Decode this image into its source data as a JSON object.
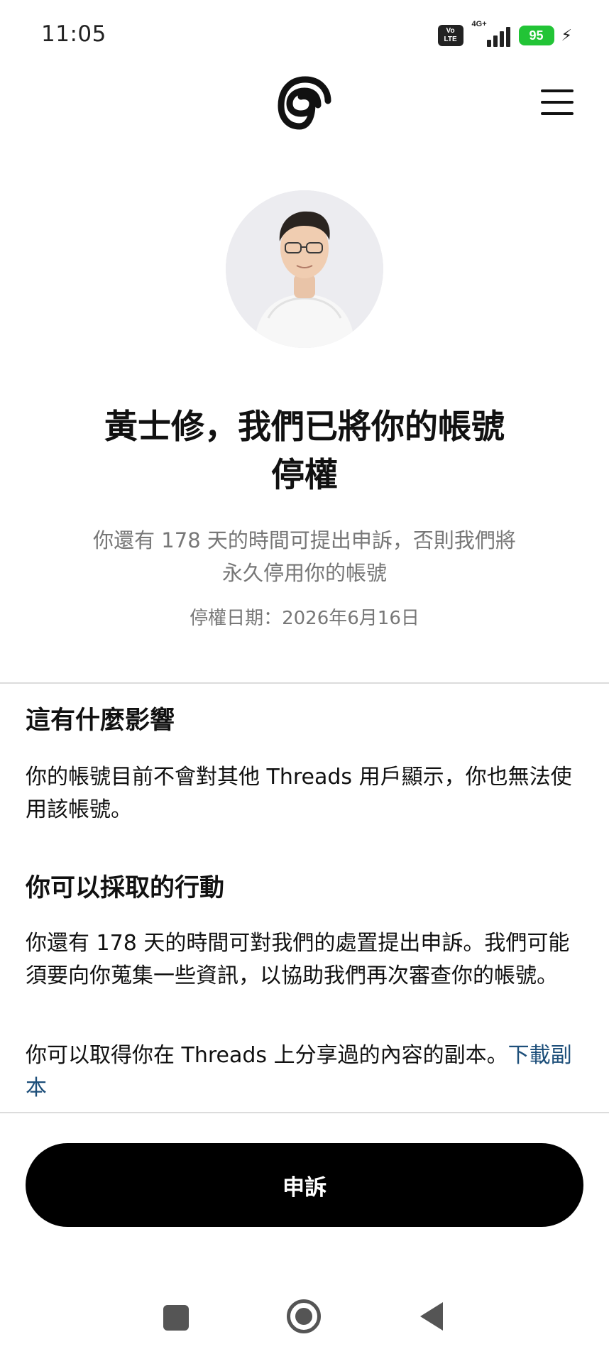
{
  "status_bar": {
    "time": "11:05",
    "volte_top": "Vo",
    "volte_bottom": "LTE",
    "network": "4G+",
    "battery": "95"
  },
  "header": {
    "logo_icon": "threads-logo-icon",
    "menu_icon": "hamburger-menu-icon"
  },
  "profile": {
    "avatar": "profile-photo"
  },
  "notice": {
    "title_line1": "黃士修，我們已將你的帳號",
    "title_line2": "停權",
    "subtitle_line1": "你還有 178 天的時間可提出申訴，否則我們將",
    "subtitle_line2": "永久停用你的帳號",
    "date": "停權日期：2026年6月16日"
  },
  "impact": {
    "heading": "這有什麼影響",
    "body": "你的帳號目前不會對其他 Threads 用戶顯示，你也無法使用該帳號。"
  },
  "actions": {
    "heading": "你可以採取的行動",
    "body": "你還有 178 天的時間可對我們的處置提出申訴。我們可能須要向你蒐集一些資訊，以協助我們再次審查你的帳號。",
    "copy_text": "你可以取得你在 Threads 上分享過的內容的副本。",
    "download_link": "下載副本"
  },
  "appeal_button": "申訴",
  "colors": {
    "link": "#1d4f7a",
    "battery": "#22c436",
    "button": "#000000"
  },
  "nav_bar": {
    "recents_icon": "square-icon",
    "home_icon": "circle-home-icon",
    "back_icon": "triangle-back-icon"
  }
}
